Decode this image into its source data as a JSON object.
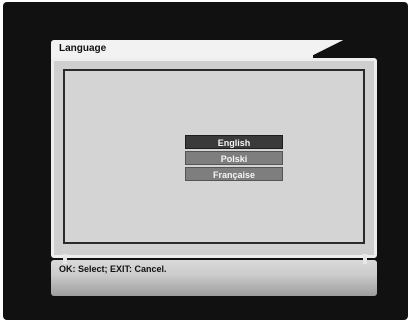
{
  "dialog": {
    "title": "Language",
    "languages": [
      {
        "label": "English",
        "selected": true
      },
      {
        "label": "Polski",
        "selected": false
      },
      {
        "label": "Française",
        "selected": false
      }
    ],
    "footer_hint": "OK: Select; EXIT: Cancel."
  },
  "colors": {
    "screen_bg": "#111111",
    "selected_item": "#3a3a3a",
    "unselected_item": "#7e7e7e",
    "panel_bg": "#d4d4d4"
  }
}
